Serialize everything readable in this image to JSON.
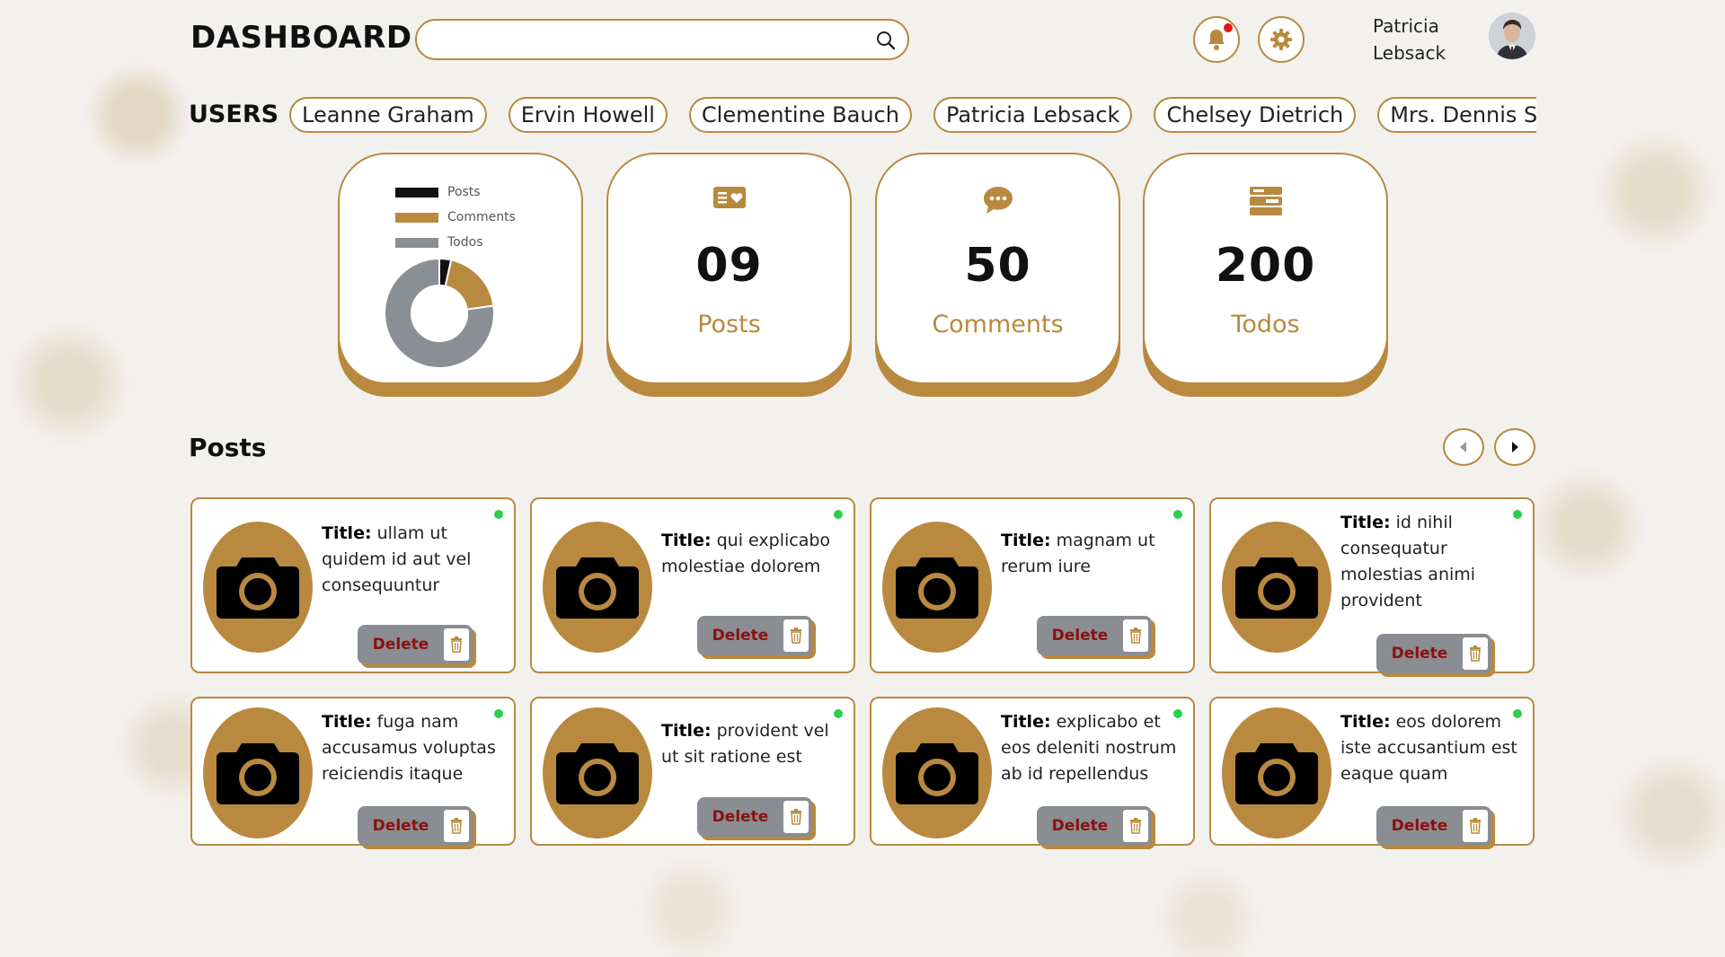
{
  "header": {
    "title": "DASHBOARD",
    "search_value": "",
    "user_first": "Patricia",
    "user_last": "Lebsack",
    "icons": {
      "search": "search-icon",
      "bell": "bell-icon",
      "settings": "gear-icon"
    }
  },
  "users": {
    "label": "USERS",
    "items": [
      "Leanne Graham",
      "Ervin Howell",
      "Clementine Bauch",
      "Patricia Lebsack",
      "Chelsey Dietrich",
      "Mrs. Dennis Schulist"
    ]
  },
  "stats": {
    "posts": {
      "value": "09",
      "label": "Posts",
      "icon": "post-icon"
    },
    "comments": {
      "value": "50",
      "label": "Comments",
      "icon": "comment-icon"
    },
    "todos": {
      "value": "200",
      "label": "Todos",
      "icon": "todo-icon"
    }
  },
  "chart_data": {
    "type": "pie",
    "categories": [
      "Posts",
      "Comments",
      "Todos"
    ],
    "values": [
      9,
      50,
      200
    ],
    "colors": [
      "#111111",
      "#b8893f",
      "#8a8f96"
    ],
    "legend": "top"
  },
  "posts": {
    "title": "Posts",
    "title_prefix": "Title:",
    "delete_label": "Delete",
    "items": [
      {
        "title": "ullam ut quidem id aut vel consequuntur"
      },
      {
        "title": "qui explicabo molestiae dolorem"
      },
      {
        "title": "magnam ut rerum iure"
      },
      {
        "title": "id nihil consequatur molestias animi provident"
      },
      {
        "title": "fuga nam accusamus voluptas reiciendis itaque"
      },
      {
        "title": "provident vel ut sit ratione est"
      },
      {
        "title": "explicabo et eos deleniti nostrum ab id repellendus"
      },
      {
        "title": "eos dolorem iste accusantium est eaque quam"
      }
    ]
  },
  "colors": {
    "accent": "#b8893f",
    "online": "#2ad04a",
    "delete_text": "#8b1010"
  }
}
